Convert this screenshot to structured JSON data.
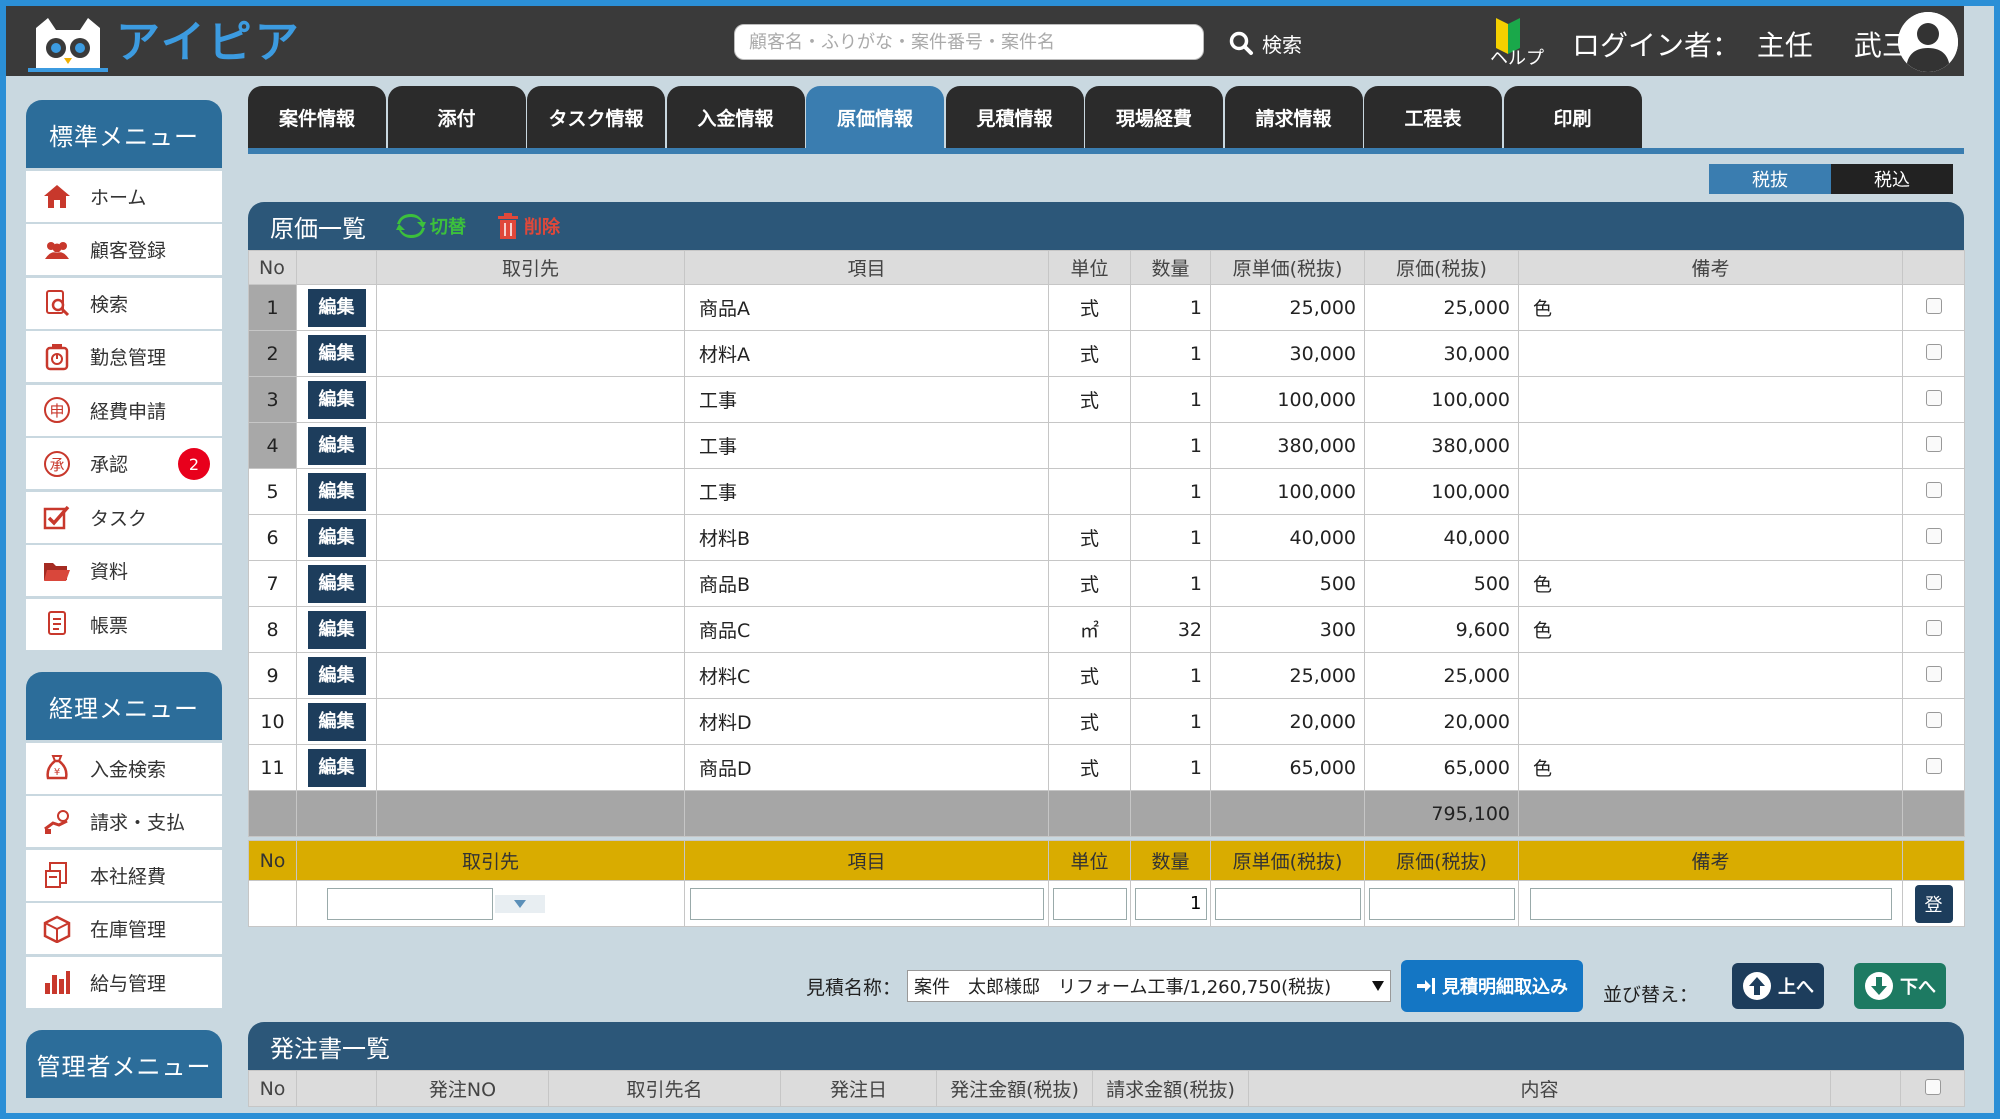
{
  "app": {
    "logo_text": "アイピア"
  },
  "search": {
    "placeholder": "顧客名・ふりがな・案件番号・案件名",
    "button_label": "検索"
  },
  "user": {
    "label": "ログイン者：",
    "role": "主任",
    "name": "武三"
  },
  "help": {
    "label": "ヘルプ"
  },
  "sidebar": {
    "standard": {
      "title": "標準メニュー",
      "items": [
        {
          "label": "ホーム",
          "icon": "home-icon"
        },
        {
          "label": "顧客登録",
          "icon": "users-icon"
        },
        {
          "label": "検索",
          "icon": "search-doc-icon"
        },
        {
          "label": "勤怠管理",
          "icon": "clock-icon"
        },
        {
          "label": "経費申請",
          "icon": "expense-icon"
        },
        {
          "label": "承認",
          "icon": "approve-icon",
          "badge": "2"
        },
        {
          "label": "タスク",
          "icon": "task-icon"
        },
        {
          "label": "資料",
          "icon": "folder-icon"
        },
        {
          "label": "帳票",
          "icon": "document-icon"
        }
      ]
    },
    "accounting": {
      "title": "経理メニュー",
      "items": [
        {
          "label": "入金検索",
          "icon": "money-bag-icon"
        },
        {
          "label": "請求・支払",
          "icon": "payment-icon"
        },
        {
          "label": "本社経費",
          "icon": "receipt-icon"
        },
        {
          "label": "在庫管理",
          "icon": "box-icon"
        },
        {
          "label": "給与管理",
          "icon": "bar-chart-icon"
        }
      ]
    },
    "admin": {
      "title": "管理者メニュー"
    }
  },
  "tabs": [
    {
      "label": "案件情報",
      "active": false
    },
    {
      "label": "添付",
      "active": false
    },
    {
      "label": "タスク情報",
      "active": false
    },
    {
      "label": "入金情報",
      "active": false
    },
    {
      "label": "原価情報",
      "active": true
    },
    {
      "label": "見積情報",
      "active": false
    },
    {
      "label": "現場経費",
      "active": false
    },
    {
      "label": "請求情報",
      "active": false
    },
    {
      "label": "工程表",
      "active": false
    },
    {
      "label": "印刷",
      "active": false
    }
  ],
  "tax_toggle": {
    "excl": "税抜",
    "incl": "税込"
  },
  "cost": {
    "title": "原価一覧",
    "switch_label": "切替",
    "delete_label": "削除",
    "edit_label": "編集",
    "headers": [
      "No",
      "",
      "取引先",
      "項目",
      "単位",
      "数量",
      "原単価(税抜)",
      "原価(税抜)",
      "備考",
      ""
    ],
    "rows": [
      {
        "no": "1",
        "vendor": "",
        "item": "商品A",
        "unit": "式",
        "qty": "1",
        "unit_price": "25,000",
        "cost": "25,000",
        "note": "色"
      },
      {
        "no": "2",
        "vendor": "",
        "item": "材料A",
        "unit": "式",
        "qty": "1",
        "unit_price": "30,000",
        "cost": "30,000",
        "note": ""
      },
      {
        "no": "3",
        "vendor": "",
        "item": "工事",
        "unit": "式",
        "qty": "1",
        "unit_price": "100,000",
        "cost": "100,000",
        "note": ""
      },
      {
        "no": "4",
        "vendor": "",
        "item": "工事",
        "unit": "",
        "qty": "1",
        "unit_price": "380,000",
        "cost": "380,000",
        "note": ""
      },
      {
        "no": "5",
        "vendor": "",
        "item": "工事",
        "unit": "",
        "qty": "1",
        "unit_price": "100,000",
        "cost": "100,000",
        "note": ""
      },
      {
        "no": "6",
        "vendor": "",
        "item": "材料B",
        "unit": "式",
        "qty": "1",
        "unit_price": "40,000",
        "cost": "40,000",
        "note": ""
      },
      {
        "no": "7",
        "vendor": "",
        "item": "商品B",
        "unit": "式",
        "qty": "1",
        "unit_price": "500",
        "cost": "500",
        "note": "色"
      },
      {
        "no": "8",
        "vendor": "",
        "item": "商品C",
        "unit": "㎡",
        "qty": "32",
        "unit_price": "300",
        "cost": "9,600",
        "note": "色"
      },
      {
        "no": "9",
        "vendor": "",
        "item": "材料C",
        "unit": "式",
        "qty": "1",
        "unit_price": "25,000",
        "cost": "25,000",
        "note": ""
      },
      {
        "no": "10",
        "vendor": "",
        "item": "材料D",
        "unit": "式",
        "qty": "1",
        "unit_price": "20,000",
        "cost": "20,000",
        "note": ""
      },
      {
        "no": "11",
        "vendor": "",
        "item": "商品D",
        "unit": "式",
        "qty": "1",
        "unit_price": "65,000",
        "cost": "65,000",
        "note": "色"
      }
    ],
    "total": "795,100"
  },
  "entry": {
    "headers": [
      "No",
      "取引先",
      "項目",
      "単位",
      "数量",
      "原単価(税抜)",
      "原価(税抜)",
      "備考",
      ""
    ],
    "qty_value": "1",
    "register_label": "登"
  },
  "import": {
    "label": "見積名称：",
    "selected": "案件　太郎様邸　リフォーム工事/1,260,750(税抜)",
    "button_label": "見積明細取込み",
    "sort_label": "並び替え：",
    "up_label": "上へ",
    "down_label": "下へ"
  },
  "orders": {
    "title": "発注書一覧",
    "headers": [
      "No",
      "",
      "発注NO",
      "取引先名",
      "発注日",
      "発注金額(税抜)",
      "請求金額(税抜)",
      "内容",
      "",
      ""
    ]
  },
  "colors": {
    "brand": "#3c9be0",
    "active_tab": "#3a7db0",
    "panel_head": "#2c5779",
    "entry_header": "#d9ac00",
    "badge": "#e8001c"
  }
}
